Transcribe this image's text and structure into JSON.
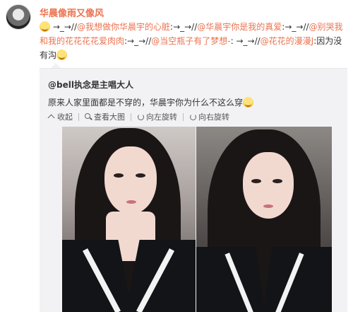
{
  "post": {
    "username": "华晨像雨又像风",
    "segments": [
      {
        "t": "emoji",
        "v": "grin-emoji"
      },
      {
        "t": "text",
        "v": " →_→//"
      },
      {
        "t": "mention",
        "v": "@我想做你华晨宇的心脏"
      },
      {
        "t": "text",
        "v": ":→_→//"
      },
      {
        "t": "mention",
        "v": "@华晨宇你是我的真爱"
      },
      {
        "t": "text",
        "v": ":→_→//"
      },
      {
        "t": "mention",
        "v": "@别哭我和我的花花花花爱肉肉"
      },
      {
        "t": "text",
        "v": ":→_→//"
      },
      {
        "t": "mention",
        "v": "@当空瓶子有了梦想-"
      },
      {
        "t": "text",
        "v": ": →_→//"
      },
      {
        "t": "mention",
        "v": "@花花的漫漫J"
      },
      {
        "t": "text",
        "v": ":因为没有沟"
      },
      {
        "t": "emoji",
        "v": "laugh-emoji"
      }
    ]
  },
  "repost": {
    "author": "@bell执念是主唱大人",
    "text": "原来人家里面都是不穿的，华晨宇你为什么不这么穿",
    "toolbar": {
      "collapse": "收起",
      "view_large": "查看大图",
      "rotate_left": "向左旋转",
      "rotate_right": "向右旋转"
    }
  },
  "colors": {
    "accent": "#eb7350",
    "repost_bg": "#f2f2f5"
  }
}
